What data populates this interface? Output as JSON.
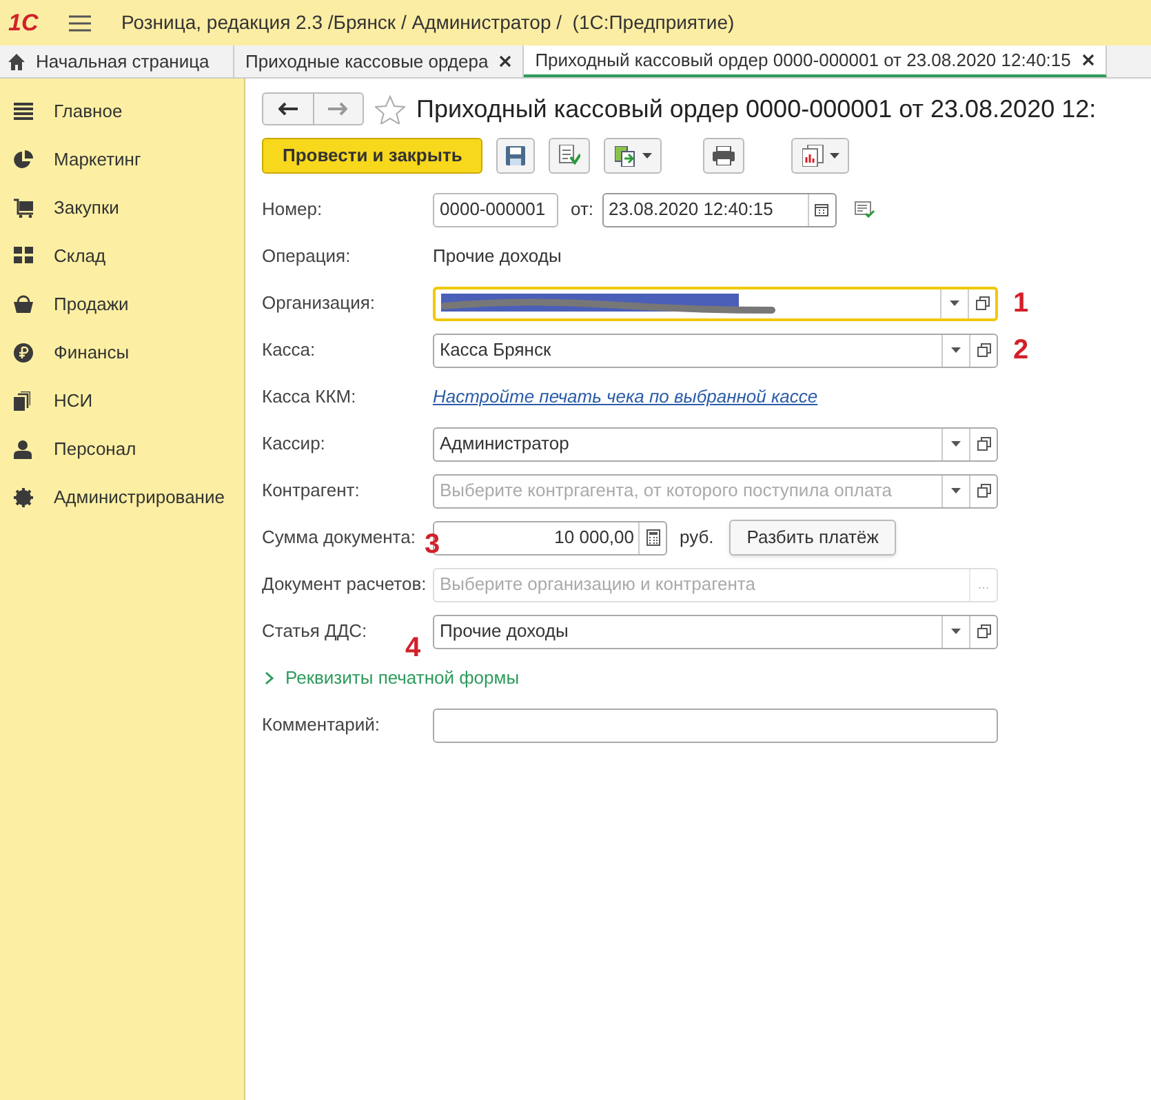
{
  "window": {
    "logo": "1С",
    "title": "Розница, редакция 2.3 /Брянск / Администратор /  (1С:Предприятие)"
  },
  "tabs": [
    {
      "label": "Начальная страница",
      "kind": "home",
      "selected": false
    },
    {
      "label": "Приходные кассовые ордера",
      "kind": "closable",
      "selected": false
    },
    {
      "label": "Приходный кассовый ордер 0000-000001 от 23.08.2020 12:40:15",
      "kind": "closable",
      "selected": true
    }
  ],
  "sidebar": {
    "items": [
      {
        "label": "Главное"
      },
      {
        "label": "Маркетинг"
      },
      {
        "label": "Закупки"
      },
      {
        "label": "Склад"
      },
      {
        "label": "Продажи"
      },
      {
        "label": "Финансы"
      },
      {
        "label": "НСИ"
      },
      {
        "label": "Персонал"
      },
      {
        "label": "Администрирование"
      }
    ]
  },
  "document": {
    "title": "Приходный кассовый ордер 0000-000001 от 23.08.2020 12:",
    "favorite": false,
    "primary_button": "Провести и закрыть",
    "rows": [
      {
        "kind": "number_date",
        "label": "Номер:",
        "value": "0000-000001",
        "date_label": "от:",
        "date": "23.08.2020 12:40:15"
      },
      {
        "kind": "text",
        "label": "Операция:",
        "value": "Прочие доходы"
      },
      {
        "kind": "redacted",
        "label": "Организация:",
        "focused": true,
        "annotation": "1"
      },
      {
        "kind": "select",
        "label": "Касса:",
        "value": "Касса Брянск",
        "focused": false,
        "annotation": "2"
      },
      {
        "kind": "link",
        "label": "Касса ККМ:",
        "value": "Настройте печать чека по выбранной кассе"
      },
      {
        "kind": "select",
        "label": "Кассир:",
        "value": "Администратор",
        "focused": false
      },
      {
        "kind": "select",
        "label": "Контрагент:",
        "placeholder": "Выберите контргагента, от которого поступила оплата",
        "focused": false
      },
      {
        "kind": "amount",
        "label": "Сумма документа:",
        "value": "10 000,00",
        "unit": "руб.",
        "button": "Разбить платёж",
        "annotation": "3"
      },
      {
        "kind": "disabled",
        "label": "Документ расчетов:",
        "placeholder": "Выберите организацию и контрагента",
        "button": "..."
      },
      {
        "kind": "select",
        "label": "Статья ДДС:",
        "value": "Прочие доходы",
        "focused": false,
        "annotation": "4"
      },
      {
        "kind": "expander",
        "label": "Реквизиты печатной формы",
        "expanded": false
      },
      {
        "kind": "input",
        "label": "Комментарий:"
      }
    ]
  }
}
